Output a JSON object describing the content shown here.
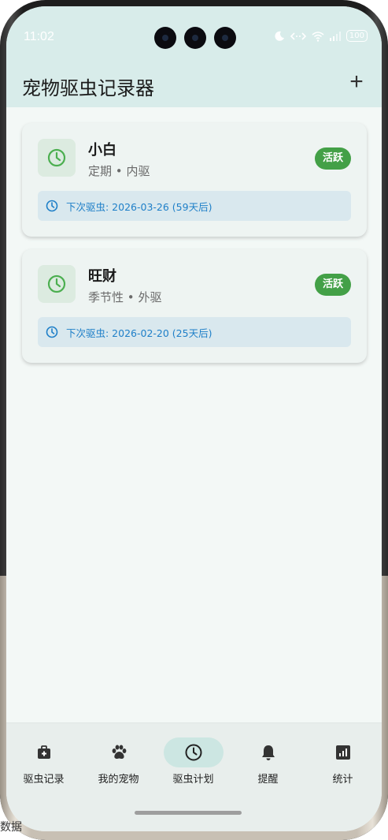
{
  "status_bar": {
    "time": "11:02",
    "battery": "100"
  },
  "app_bar": {
    "title": "宠物驱虫记录器",
    "add_label": "+"
  },
  "plans": [
    {
      "name": "小白",
      "type": "定期",
      "category": "内驱",
      "status": "活跃",
      "next": "下次驱虫: 2026-03-26 (59天后)"
    },
    {
      "name": "旺财",
      "type": "季节性",
      "category": "外驱",
      "status": "活跃",
      "next": "下次驱虫: 2026-02-20 (25天后)"
    }
  ],
  "separator": "•",
  "nav": [
    {
      "label": "驱虫记录",
      "icon": "medical-kit-icon"
    },
    {
      "label": "我的宠物",
      "icon": "paw-icon"
    },
    {
      "label": "驱虫计划",
      "icon": "clock-icon"
    },
    {
      "label": "提醒",
      "icon": "bell-icon"
    },
    {
      "label": "统计",
      "icon": "chart-icon"
    }
  ],
  "colors": {
    "accent_green": "#43a047",
    "link_blue": "#1e7fc8",
    "header_bg": "#d8ecea"
  },
  "edge_text": "数据"
}
